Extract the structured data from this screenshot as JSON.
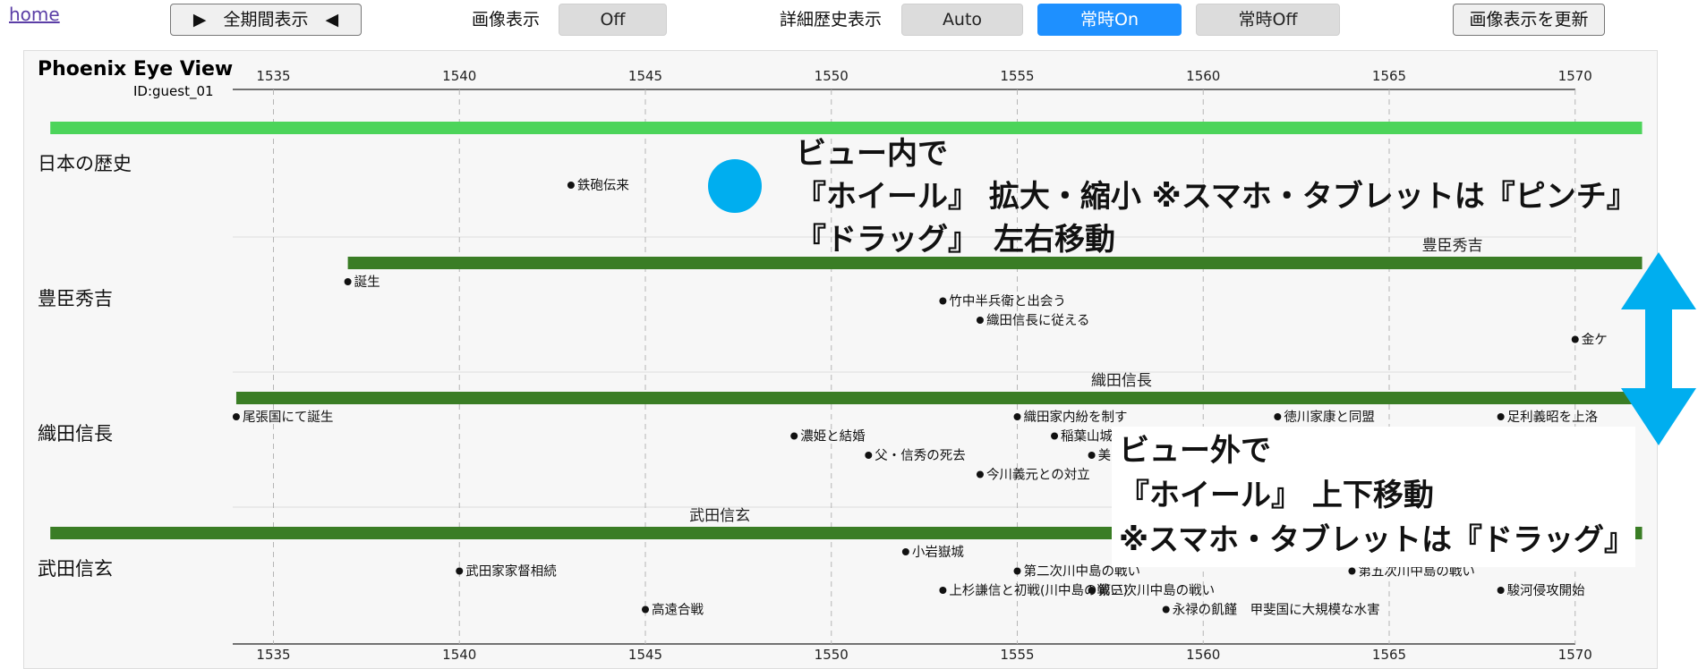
{
  "top_bar": {
    "home_link": "home",
    "full_period_button": "▶　全期間表示　◀",
    "image_display_label": "画像表示",
    "image_display_off": "Off",
    "detail_history_label": "詳細歴史表示",
    "detail_auto": "Auto",
    "detail_always_on": "常時On",
    "detail_always_off": "常時Off",
    "update_image_button": "画像表示を更新"
  },
  "panel": {
    "title": "Phoenix Eye View",
    "user_id": "ID:guest_01"
  },
  "axis": {
    "ticks": [
      1535,
      1540,
      1545,
      1550,
      1555,
      1560,
      1565,
      1570
    ]
  },
  "rows": [
    {
      "label": "日本の歴史"
    },
    {
      "label": "豊臣秀吉"
    },
    {
      "label": "織田信長"
    },
    {
      "label": "武田信玄"
    }
  ],
  "colors": {
    "japan_bar": "#4cd45a",
    "person_bar": "#3a7d25",
    "accent_blue": "#00aeef",
    "active_button": "#1e90ff"
  },
  "bars": [
    {
      "row": 0,
      "start": 1529,
      "end": 1571.8,
      "label": "",
      "color": "#4cd45a"
    },
    {
      "row": 1,
      "start": 1537,
      "end": 1571.8,
      "label": "豊臣秀吉",
      "label_year": 1566.7,
      "color": "#3a7d25"
    },
    {
      "row": 2,
      "start": 1534,
      "end": 1571.8,
      "label": "織田信長",
      "label_year": 1557.8,
      "color": "#3a7d25"
    },
    {
      "row": 3,
      "start": 1529,
      "end": 1571.8,
      "label": "武田信玄",
      "label_year": 1547,
      "color": "#3a7d25"
    }
  ],
  "events": [
    {
      "row": 0,
      "year": 1543,
      "line": 0,
      "text": "鉄砲伝来"
    },
    {
      "row": 1,
      "year": 1537,
      "line": 0,
      "text": "誕生"
    },
    {
      "row": 1,
      "year": 1553,
      "line": 1,
      "text": "竹中半兵衛と出会う"
    },
    {
      "row": 1,
      "year": 1554,
      "line": 2,
      "text": "織田信長に従える"
    },
    {
      "row": 1,
      "year": 1570,
      "line": 3,
      "text": "金ケ"
    },
    {
      "row": 2,
      "year": 1534,
      "line": 0,
      "text": "尾張国にて誕生"
    },
    {
      "row": 2,
      "year": 1555,
      "line": 0,
      "text": "織田家内紛を制す"
    },
    {
      "row": 2,
      "year": 1562,
      "line": 0,
      "text": "徳川家康と同盟"
    },
    {
      "row": 2,
      "year": 1568,
      "line": 0,
      "text": "足利義昭を上洛"
    },
    {
      "row": 2,
      "year": 1549,
      "line": 1,
      "text": "濃姫と結婚"
    },
    {
      "row": 2,
      "year": 1556,
      "line": 1,
      "text": "稲葉山城"
    },
    {
      "row": 2,
      "year": 1551,
      "line": 2,
      "text": "父・信秀の死去"
    },
    {
      "row": 2,
      "year": 1557,
      "line": 2,
      "text": "美"
    },
    {
      "row": 2,
      "year": 1554,
      "line": 3,
      "text": "今川義元との対立"
    },
    {
      "row": 3,
      "year": 1552,
      "line": 0,
      "text": "小岩嶽城"
    },
    {
      "row": 3,
      "year": 1540,
      "line": 1,
      "text": "武田家家督相続"
    },
    {
      "row": 3,
      "year": 1555,
      "line": 1,
      "text": "第二次川中島の戦い"
    },
    {
      "row": 3,
      "year": 1564,
      "line": 1,
      "text": "第五次川中島の戦い"
    },
    {
      "row": 3,
      "year": 1553,
      "line": 2,
      "text": "上杉謙信と初戦(川中島の戦い)"
    },
    {
      "row": 3,
      "year": 1557,
      "line": 2,
      "text": "第三次川中島の戦い"
    },
    {
      "row": 3,
      "year": 1568,
      "line": 2,
      "text": "駿河侵攻開始"
    },
    {
      "row": 3,
      "year": 1545,
      "line": 3,
      "text": "高遠合戦"
    },
    {
      "row": 3,
      "year": 1559,
      "line": 3,
      "text": "永禄の飢饉　甲斐国に大規模な水害"
    }
  ],
  "overlay_inside": {
    "line1": "ビュー内で",
    "line2": "『ホイール』 拡大・縮小 ※スマホ・タブレットは『ピンチ』",
    "line3": "『ドラッグ』　左右移動"
  },
  "overlay_outside": {
    "line1": "ビュー外で",
    "line2": "『ホイール』 上下移動",
    "line3": "※スマホ・タブレットは『ドラッグ』"
  }
}
